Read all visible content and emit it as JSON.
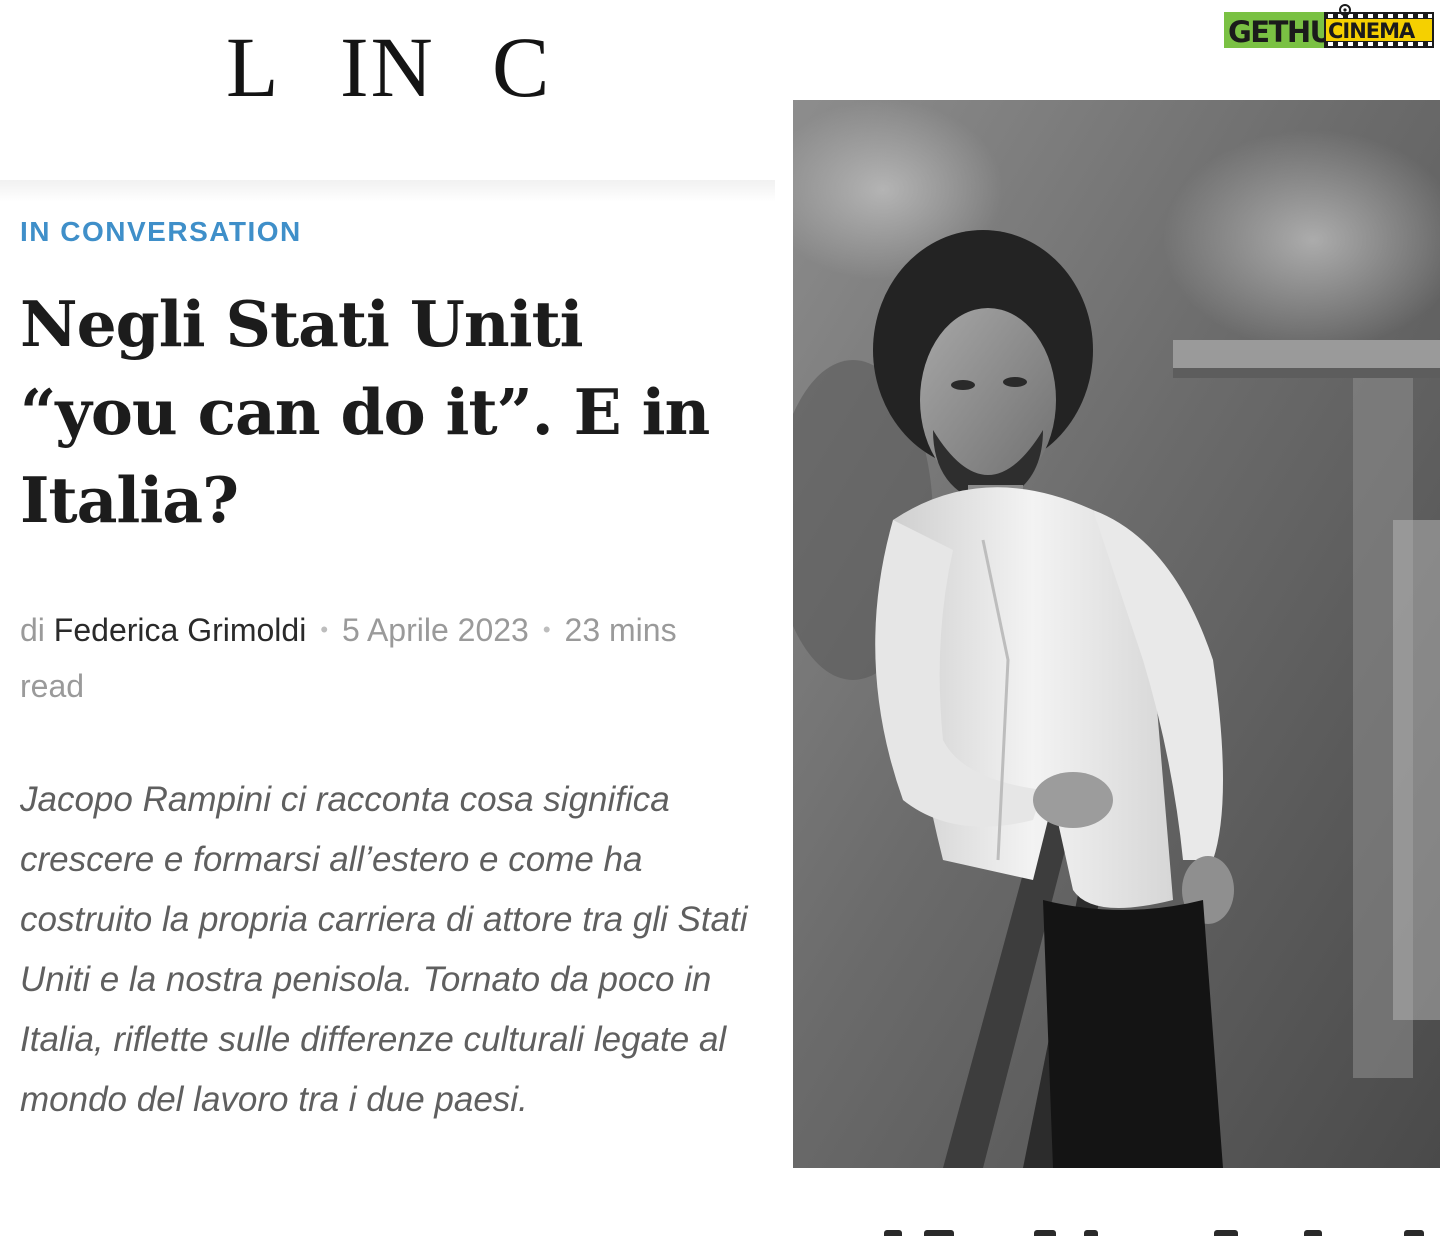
{
  "masthead": {
    "letters": [
      "L",
      "IN",
      "C"
    ]
  },
  "watermark": {
    "part1": "GETHU",
    "part2": "CINEMA",
    "colors": {
      "green": "#7ac143",
      "dark": "#1b1b1b",
      "yellow": "#f5d000"
    }
  },
  "article": {
    "category": "IN CONVERSATION",
    "headline": "Negli Stati Uniti “you can do it”. E in Italia?",
    "byline": {
      "prefix": "di",
      "author": "Federica Grimoldi",
      "date": "5 Aprile 2023",
      "read_time": "23 mins read",
      "separator": "•"
    },
    "excerpt": "Jacopo Rampini ci racconta cosa significa crescere e formarsi all’estero e come ha costruito la propria carriera di attore tra gli Stati Uniti e la nostra penisola. Tornato da poco in Italia, riflette sulle differenze culturali legate al mondo del lavoro tra i due paesi."
  },
  "photo": {
    "style": "black-and-white portrait"
  },
  "colors": {
    "category": "#3f8fc9",
    "headline": "#1c1c1c",
    "byline_muted": "#9a9a9a",
    "excerpt": "#5f5f5f"
  }
}
